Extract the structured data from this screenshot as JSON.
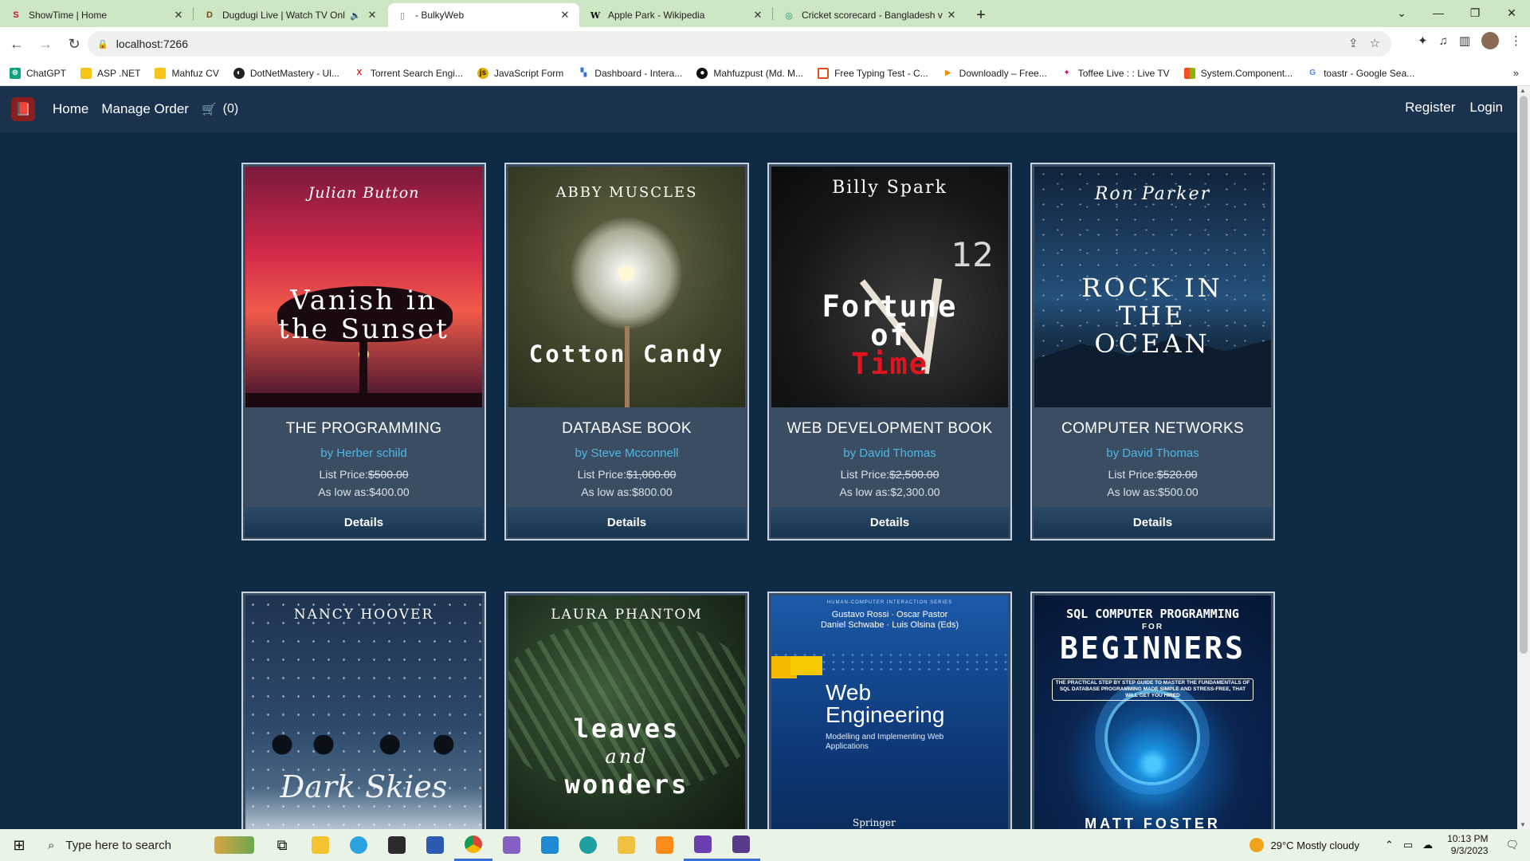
{
  "browser": {
    "tabs": [
      {
        "title": "ShowTime | Home",
        "favicon": "S",
        "favicon_color": "#c8102e"
      },
      {
        "title": "Dugdugi Live | Watch TV Onl",
        "favicon": "D",
        "favicon_color": "#7a4a10"
      },
      {
        "title": "- BulkyWeb",
        "favicon": "▯",
        "favicon_color": "#777777"
      },
      {
        "title": "Apple Park - Wikipedia",
        "favicon": "W",
        "favicon_color": "#111111"
      },
      {
        "title": "Cricket scorecard - Bangladesh v",
        "favicon": "◎",
        "favicon_color": "#1a8f6a"
      }
    ],
    "active_tab_index": 2,
    "url": "localhost:7266",
    "bookmarks": [
      {
        "label": "ChatGPT",
        "icon_color": "#10a37f"
      },
      {
        "label": "ASP .NET",
        "icon_color": "#f5c518"
      },
      {
        "label": "Mahfuz CV",
        "icon_color": "#f5c518"
      },
      {
        "label": "DotNetMastery - Ul...",
        "icon_color": "#222222"
      },
      {
        "label": "Torrent Search Engi...",
        "icon_color": "#d11a1a"
      },
      {
        "label": "JavaScript Form",
        "icon_color": "#e2b007"
      },
      {
        "label": "Dashboard - Intera...",
        "icon_color": "#3b6fd8"
      },
      {
        "label": "Mahfuzpust (Md. M...",
        "icon_color": "#111111"
      },
      {
        "label": "Free Typing Test - C...",
        "icon_color": "#e24a1a"
      },
      {
        "label": "Downloadly – Free...",
        "icon_color": "#f08a00"
      },
      {
        "label": "Toffee Live : : Live TV",
        "icon_color": "#c2187a"
      },
      {
        "label": "System.Component...",
        "icon_color": "#f25022"
      },
      {
        "label": "toastr - Google Sea...",
        "icon_color": "#4285f4"
      }
    ]
  },
  "app": {
    "nav": {
      "home": "Home",
      "manage_order": "Manage Order",
      "cart_count": "(0)",
      "register": "Register",
      "login": "Login"
    },
    "products": [
      {
        "title": "THE PROGRAMMING",
        "author": "by Herber schild",
        "list_price_label": "List Price:",
        "list_price": "$500.00",
        "low_label": "As low as:",
        "low_price": "$400.00",
        "details": "Details",
        "cover_author": "Julian Button",
        "cover_title": "Vanish in the Sunset"
      },
      {
        "title": "DATABASE BOOK",
        "author": "by Steve Mcconnell",
        "list_price_label": "List Price:",
        "list_price": "$1,000.00",
        "low_label": "As low as:",
        "low_price": "$800.00",
        "details": "Details",
        "cover_author": "ABBY MUSCLES",
        "cover_title": "Cotton Candy"
      },
      {
        "title": "WEB DEVELOPMENT BOOK",
        "author": "by David Thomas",
        "list_price_label": "List Price:",
        "list_price": "$2,500.00",
        "low_label": "As low as:",
        "low_price": "$2,300.00",
        "details": "Details",
        "cover_author": "Billy Spark",
        "cover_title_line1": "Fortune",
        "cover_title_line2": "of",
        "cover_title_line3": "Time"
      },
      {
        "title": "COMPUTER NETWORKS",
        "author": "by David Thomas",
        "list_price_label": "List Price:",
        "list_price": "$520.00",
        "low_label": "As low as:",
        "low_price": "$500.00",
        "details": "Details",
        "cover_author": "Ron Parker",
        "cover_title": "ROCK IN THE OCEAN"
      },
      {
        "cover_author": "NANCY HOOVER",
        "cover_title": "Dark Skies"
      },
      {
        "cover_author": "LAURA PHANTOM",
        "cover_title_line1": "leaves",
        "cover_title_line2": "and",
        "cover_title_line3": "wonders"
      },
      {
        "cover_series": "HUMAN-COMPUTER INTERACTION SERIES",
        "cover_editors_1": "Gustavo Rossi · Oscar Pastor",
        "cover_editors_2": "Daniel Schwabe · Luis Olsina (Eds)",
        "cover_title": "Web Engineering",
        "cover_subtitle": "Modelling and Implementing Web Applications",
        "cover_publisher": "Springer"
      },
      {
        "cover_top": "SQL COMPUTER PROGRAMMING",
        "cover_for": "FOR",
        "cover_title": "BEGINNERS",
        "cover_blurb": "THE PRACTICAL STEP BY STEP GUIDE TO MASTER THE FUNDAMENTALS OF SQL DATABASE PROGRAMMING MADE SIMPLE AND STRESS-FREE, THAT WILL GET YOU HIRED",
        "cover_author": "MATT FOSTER"
      }
    ]
  },
  "taskbar": {
    "search_placeholder": "Type here to search",
    "weather": "29°C  Mostly cloudy",
    "time": "10:13 PM",
    "date": "9/3/2023"
  }
}
